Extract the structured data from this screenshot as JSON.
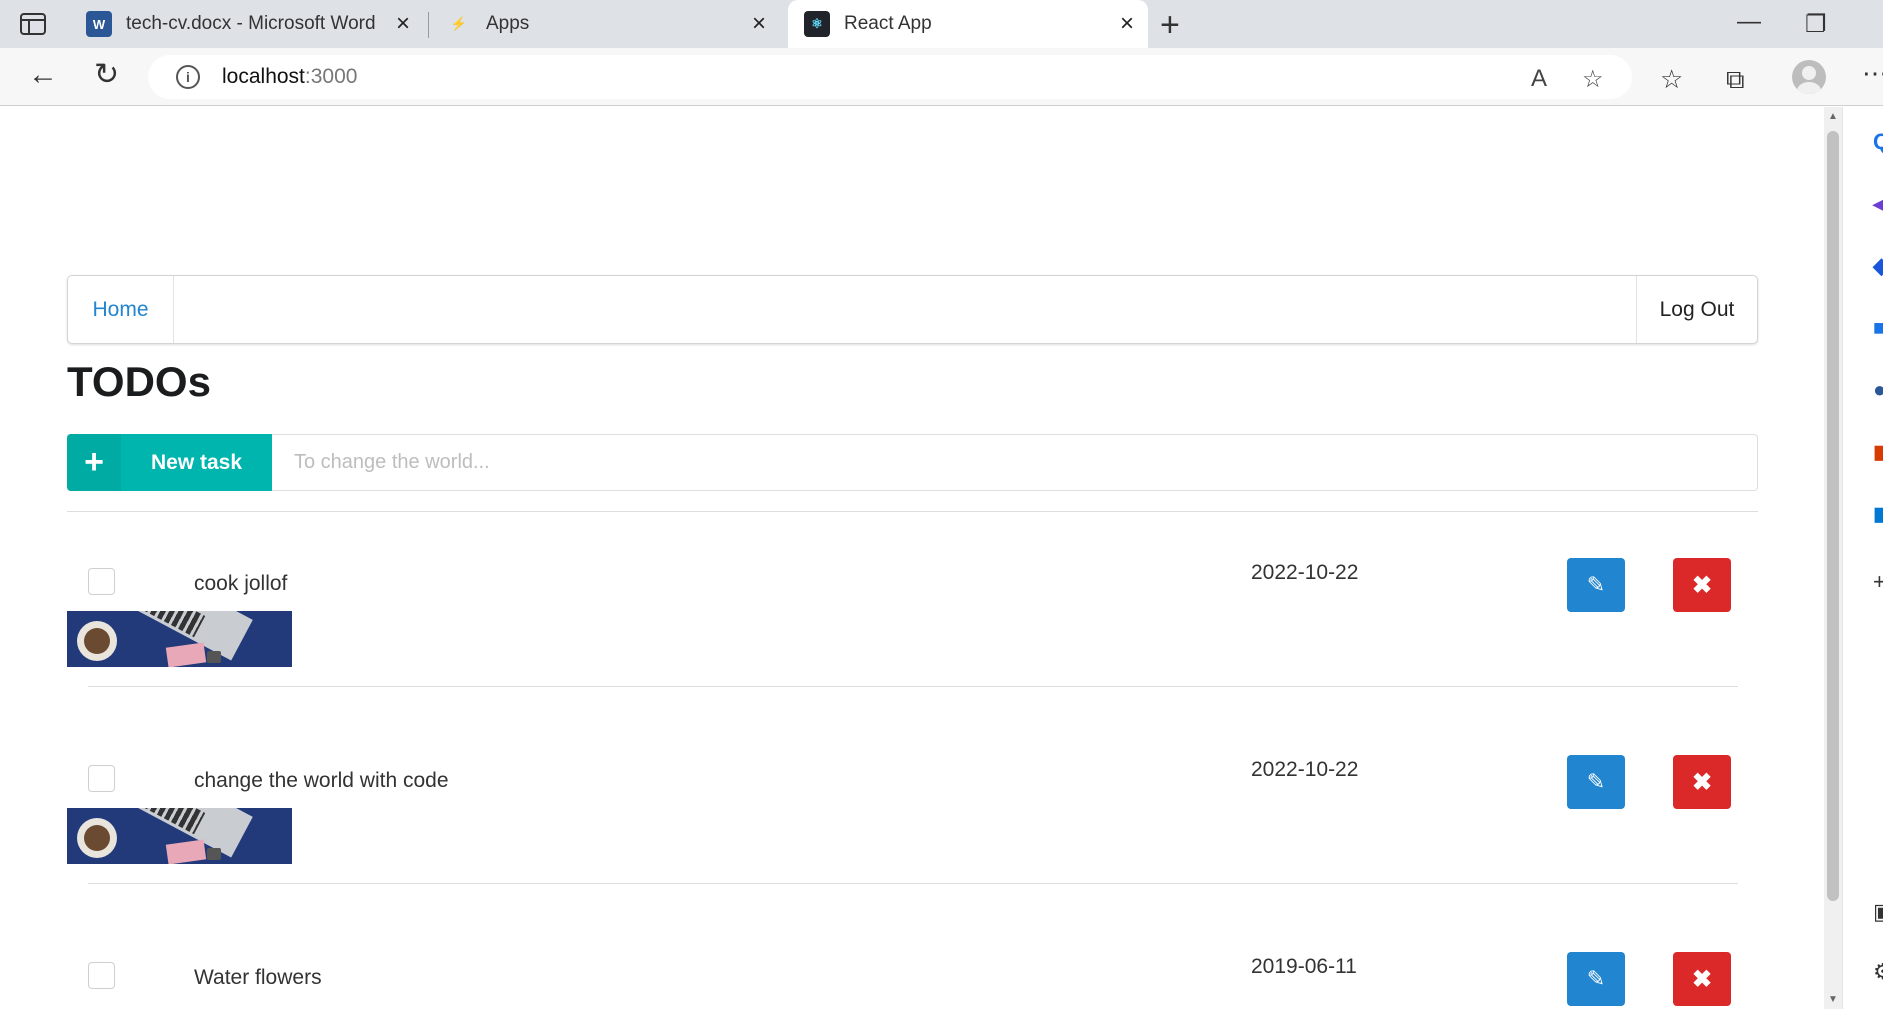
{
  "browser": {
    "tabs": [
      {
        "title": "tech-cv.docx - Microsoft Word Online",
        "favicon": "word-icon",
        "active": false
      },
      {
        "title": "Apps",
        "favicon": "apps-icon",
        "active": false
      },
      {
        "title": "React App",
        "favicon": "react-icon",
        "active": true
      }
    ],
    "url_host": "localhost",
    "url_port": ":3000"
  },
  "nav": {
    "home_label": "Home",
    "logout_label": "Log Out"
  },
  "page": {
    "title": "TODOs"
  },
  "new_task": {
    "button_label": "New task",
    "placeholder": "To change the world..."
  },
  "todos": [
    {
      "text": "cook jollof",
      "date": "2022-10-22",
      "done": false
    },
    {
      "text": "change the world with code",
      "date": "2022-10-22",
      "done": false
    },
    {
      "text": "Water flowers",
      "date": "2019-06-11",
      "done": false
    }
  ],
  "colors": {
    "teal": "#00b5ad",
    "blue": "#2185d0",
    "red": "#db2828"
  }
}
